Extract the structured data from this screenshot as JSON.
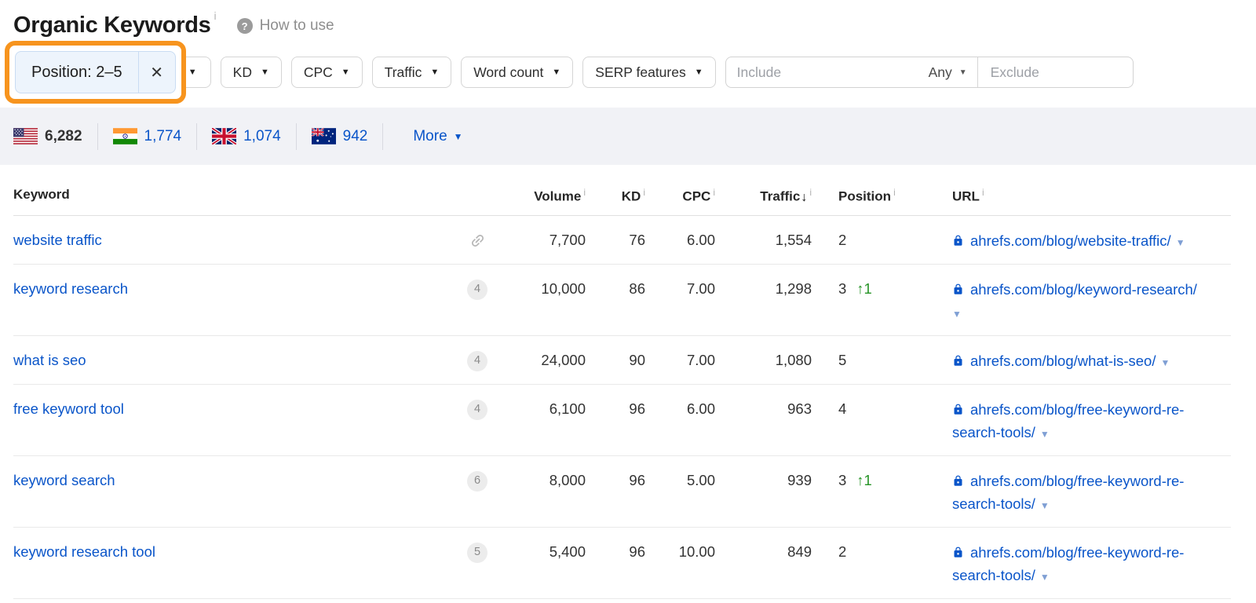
{
  "header": {
    "title": "Organic Keywords",
    "help_label": "How to use"
  },
  "icons": {
    "caret_down": "▼",
    "sort_desc": "↓",
    "close": "✕",
    "help": "?",
    "info": "i"
  },
  "filters": {
    "chip": {
      "label": "Position: 2–5"
    },
    "buttons": [
      {
        "label": "KD"
      },
      {
        "label": "CPC"
      },
      {
        "label": "Traffic"
      },
      {
        "label": "Word count"
      },
      {
        "label": "SERP features"
      }
    ],
    "include_placeholder": "Include",
    "match_mode": "Any",
    "exclude_placeholder": "Exclude"
  },
  "country_stats": {
    "items": [
      {
        "country": "us",
        "value": "6,282"
      },
      {
        "country": "in",
        "value": "1,774"
      },
      {
        "country": "gb",
        "value": "1,074"
      },
      {
        "country": "au",
        "value": "942"
      }
    ],
    "more_label": "More"
  },
  "table": {
    "columns": [
      {
        "label": "Keyword"
      },
      {
        "label": "Volume"
      },
      {
        "label": "KD"
      },
      {
        "label": "CPC"
      },
      {
        "label": "Traffic"
      },
      {
        "label": "Position"
      },
      {
        "label": "URL"
      }
    ],
    "rows": [
      {
        "keyword": "website traffic",
        "indicator": "",
        "volume": "7,700",
        "kd": "76",
        "cpc": "6.00",
        "traffic": "1,554",
        "position": "2",
        "change": "",
        "url_lines": [
          "ahrefs.com/blog/website-traffic/"
        ]
      },
      {
        "keyword": "keyword research",
        "indicator": "4",
        "volume": "10,000",
        "kd": "86",
        "cpc": "7.00",
        "traffic": "1,298",
        "position": "3",
        "change": "↑1",
        "url_lines": [
          "ahrefs.com/blog/keyword-research/",
          ""
        ]
      },
      {
        "keyword": "what is seo",
        "indicator": "4",
        "volume": "24,000",
        "kd": "90",
        "cpc": "7.00",
        "traffic": "1,080",
        "position": "5",
        "change": "",
        "url_lines": [
          "ahrefs.com/blog/what-is-seo/"
        ]
      },
      {
        "keyword": "free keyword tool",
        "indicator": "4",
        "volume": "6,100",
        "kd": "96",
        "cpc": "6.00",
        "traffic": "963",
        "position": "4",
        "change": "",
        "url_lines": [
          "ahrefs.com/blog/free-keyword-re-",
          "search-tools/"
        ]
      },
      {
        "keyword": "keyword search",
        "indicator": "6",
        "volume": "8,000",
        "kd": "96",
        "cpc": "5.00",
        "traffic": "939",
        "position": "3",
        "change": "↑1",
        "url_lines": [
          "ahrefs.com/blog/free-keyword-re-",
          "search-tools/"
        ]
      },
      {
        "keyword": "keyword research tool",
        "indicator": "5",
        "volume": "5,400",
        "kd": "96",
        "cpc": "10.00",
        "traffic": "849",
        "position": "2",
        "change": "",
        "url_lines": [
          "ahrefs.com/blog/free-keyword-re-",
          "search-tools/"
        ]
      }
    ]
  },
  "colors": {
    "link_blue": "#0a55c9",
    "annotation_orange": "#f7941e",
    "positive_green": "#279427",
    "stats_band_bg": "#f1f2f6"
  }
}
